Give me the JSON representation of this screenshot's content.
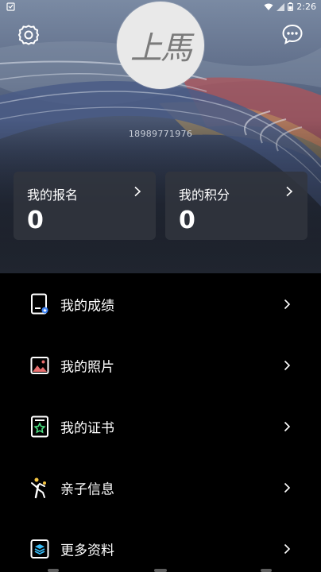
{
  "status_bar": {
    "time": "2:26",
    "icons": [
      "notification-icon",
      "wifi-icon",
      "signal-icon",
      "battery-icon"
    ]
  },
  "header": {
    "avatar_text": "上馬",
    "phone": "18989771976",
    "icons": {
      "settings": "gear-icon",
      "messages": "chat-bubble-icon"
    }
  },
  "stats": [
    {
      "label": "我的报名",
      "value": "0"
    },
    {
      "label": "我的积分",
      "value": "0"
    }
  ],
  "menu": [
    {
      "label": "我的成绩",
      "icon": "score-report-icon"
    },
    {
      "label": "我的照片",
      "icon": "photo-icon"
    },
    {
      "label": "我的证书",
      "icon": "certificate-icon"
    },
    {
      "label": "亲子信息",
      "icon": "family-runner-icon"
    },
    {
      "label": "更多资料",
      "icon": "more-info-icon"
    }
  ],
  "colors": {
    "background": "#000000",
    "card": "#32363e",
    "accent_blue": "#3b82f6",
    "accent_green": "#4ade80",
    "accent_red": "#e76f6f",
    "accent_yellow": "#f5c542"
  }
}
